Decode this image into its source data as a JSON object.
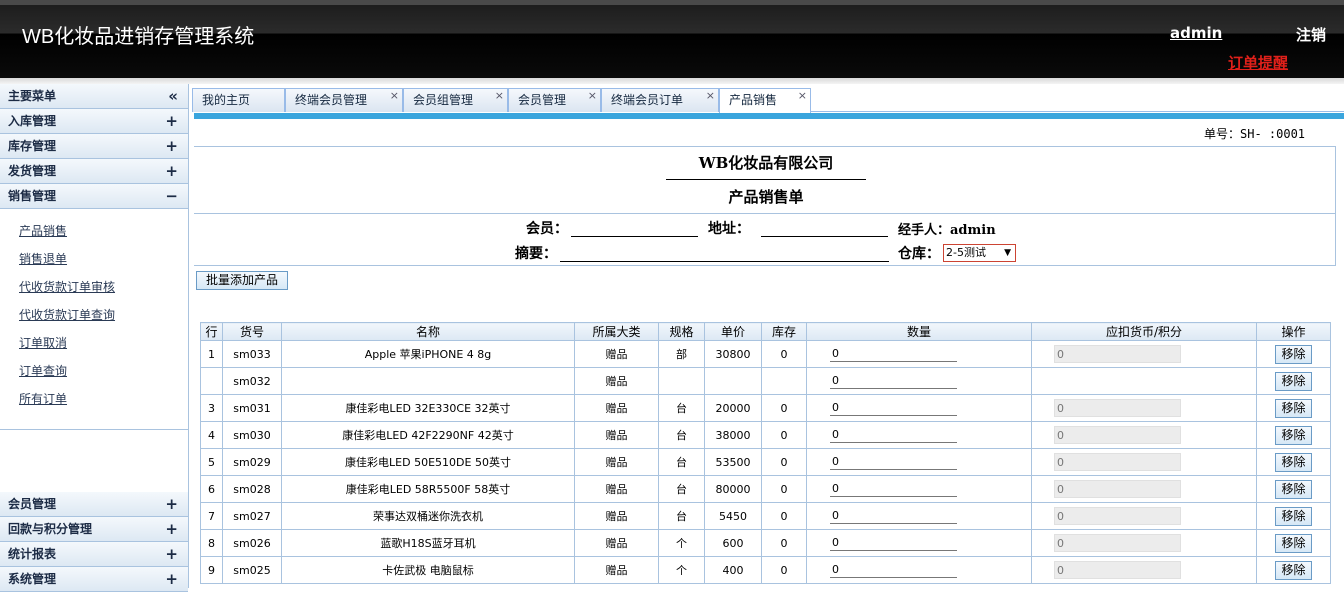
{
  "header": {
    "app_title": "WB化妆品进销存管理系统",
    "user": "admin",
    "logout": "注销",
    "order_alert": "订单提醒"
  },
  "sidebar": {
    "title": "主要菜单",
    "title_icon": "double-chevron-left-icon",
    "sections_top": [
      {
        "label": "入库管理",
        "symbol": "+"
      },
      {
        "label": "库存管理",
        "symbol": "+"
      },
      {
        "label": "发货管理",
        "symbol": "+"
      },
      {
        "label": "销售管理",
        "symbol": "−"
      }
    ],
    "sales_items": [
      "产品销售",
      "销售退单",
      "代收货款订单审核",
      "代收货款订单查询",
      "订单取消",
      "订单查询",
      "所有订单"
    ],
    "sections_bottom": [
      {
        "label": "会员管理",
        "symbol": "+"
      },
      {
        "label": "回款与积分管理",
        "symbol": "+"
      },
      {
        "label": "统计报表",
        "symbol": "+"
      },
      {
        "label": "系统管理",
        "symbol": "+"
      }
    ]
  },
  "tabs": [
    {
      "label": "我的主页",
      "closable": false
    },
    {
      "label": "终端会员管理",
      "closable": true
    },
    {
      "label": "会员组管理",
      "closable": true
    },
    {
      "label": "会员管理",
      "closable": true
    },
    {
      "label": "终端会员订单",
      "closable": true
    },
    {
      "label": "产品销售",
      "closable": true,
      "active": true
    }
  ],
  "form": {
    "doc_no": "单号：SH-         :0001",
    "company": "WB化妆品有限公司",
    "doc_title": "产品销售单",
    "member_label": "会员：",
    "address_label": "地址：",
    "handler": "经手人：admin",
    "summary_label": "摘要：",
    "warehouse_label": "仓库：",
    "warehouse_value": "2-5测试",
    "batch_add": "批量添加产品"
  },
  "table": {
    "headers": [
      "行",
      "货号",
      "名称",
      "所属大类",
      "规格",
      "单价",
      "库存",
      "数量",
      "应扣货币/积分",
      "操作"
    ],
    "remove_label": "移除",
    "rows": [
      {
        "row": "1",
        "sku": "sm033",
        "name": "Apple 苹果iPHONE 4 8g",
        "category": "赠品",
        "unit": "部",
        "price": "30800",
        "stock": "0",
        "qty": "0",
        "points": "0"
      },
      {
        "row": "",
        "sku": "sm032",
        "name": "",
        "category": "赠品",
        "unit": "",
        "price": "",
        "stock": "",
        "qty": "0",
        "points": ""
      },
      {
        "row": "3",
        "sku": "sm031",
        "name": "康佳彩电LED 32E330CE 32英寸",
        "category": "赠品",
        "unit": "台",
        "price": "20000",
        "stock": "0",
        "qty": "0",
        "points": "0"
      },
      {
        "row": "4",
        "sku": "sm030",
        "name": "康佳彩电LED 42F2290NF 42英寸",
        "category": "赠品",
        "unit": "台",
        "price": "38000",
        "stock": "0",
        "qty": "0",
        "points": "0"
      },
      {
        "row": "5",
        "sku": "sm029",
        "name": "康佳彩电LED 50E510DE 50英寸",
        "category": "赠品",
        "unit": "台",
        "price": "53500",
        "stock": "0",
        "qty": "0",
        "points": "0"
      },
      {
        "row": "6",
        "sku": "sm028",
        "name": "康佳彩电LED 58R5500F 58英寸",
        "category": "赠品",
        "unit": "台",
        "price": "80000",
        "stock": "0",
        "qty": "0",
        "points": "0"
      },
      {
        "row": "7",
        "sku": "sm027",
        "name": "荣事达双桶迷你洗衣机",
        "category": "赠品",
        "unit": "台",
        "price": "5450",
        "stock": "0",
        "qty": "0",
        "points": "0"
      },
      {
        "row": "8",
        "sku": "sm026",
        "name": "蓝歌H18S蓝牙耳机",
        "category": "赠品",
        "unit": "个",
        "price": "600",
        "stock": "0",
        "qty": "0",
        "points": "0"
      },
      {
        "row": "9",
        "sku": "sm025",
        "name": "卡佐武极 电脑鼠标",
        "category": "赠品",
        "unit": "个",
        "price": "400",
        "stock": "0",
        "qty": "0",
        "points": "0"
      }
    ]
  }
}
